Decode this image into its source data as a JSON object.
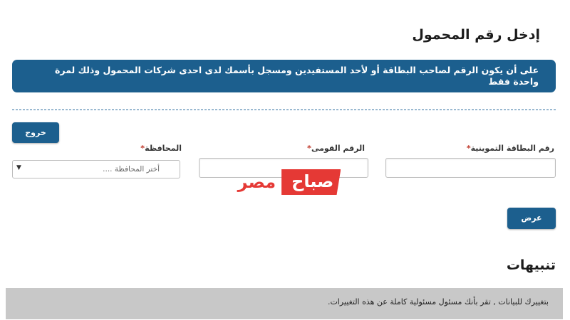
{
  "page": {
    "title": "إدخل رقم المحمول",
    "notice": "على أن يكون الرقم لصاحب البطاقة أو لأحد المستفيدين ومسجل بأسمك لدى احدى شركات المحمول وذلك لمرة واحدة فقط"
  },
  "form": {
    "exit_label": "خروج",
    "card_number": {
      "label": "رقم البطاقة التموينية",
      "required_mark": "*",
      "value": ""
    },
    "national_id": {
      "label": "الرقم القومى",
      "required_mark": "*",
      "value": ""
    },
    "governorate": {
      "label": "المحافظة",
      "required_mark": "*",
      "placeholder": "أختر المحافظة ....",
      "arrow_icon": "caret-down-icon"
    },
    "show_label": "عرض"
  },
  "watermark": {
    "box_text": "صباح",
    "plain_text": "مصر"
  },
  "notes": {
    "heading": "تنبيهات",
    "text": "بتغييرك للبيانات , تقر بأنك مسئول مسئولية كاملة عن هذه التغييرات."
  },
  "colors": {
    "primary": "#1c5f8e",
    "note_background": "#c8c8c8",
    "required": "#c0392b",
    "watermark": "#e53935"
  }
}
